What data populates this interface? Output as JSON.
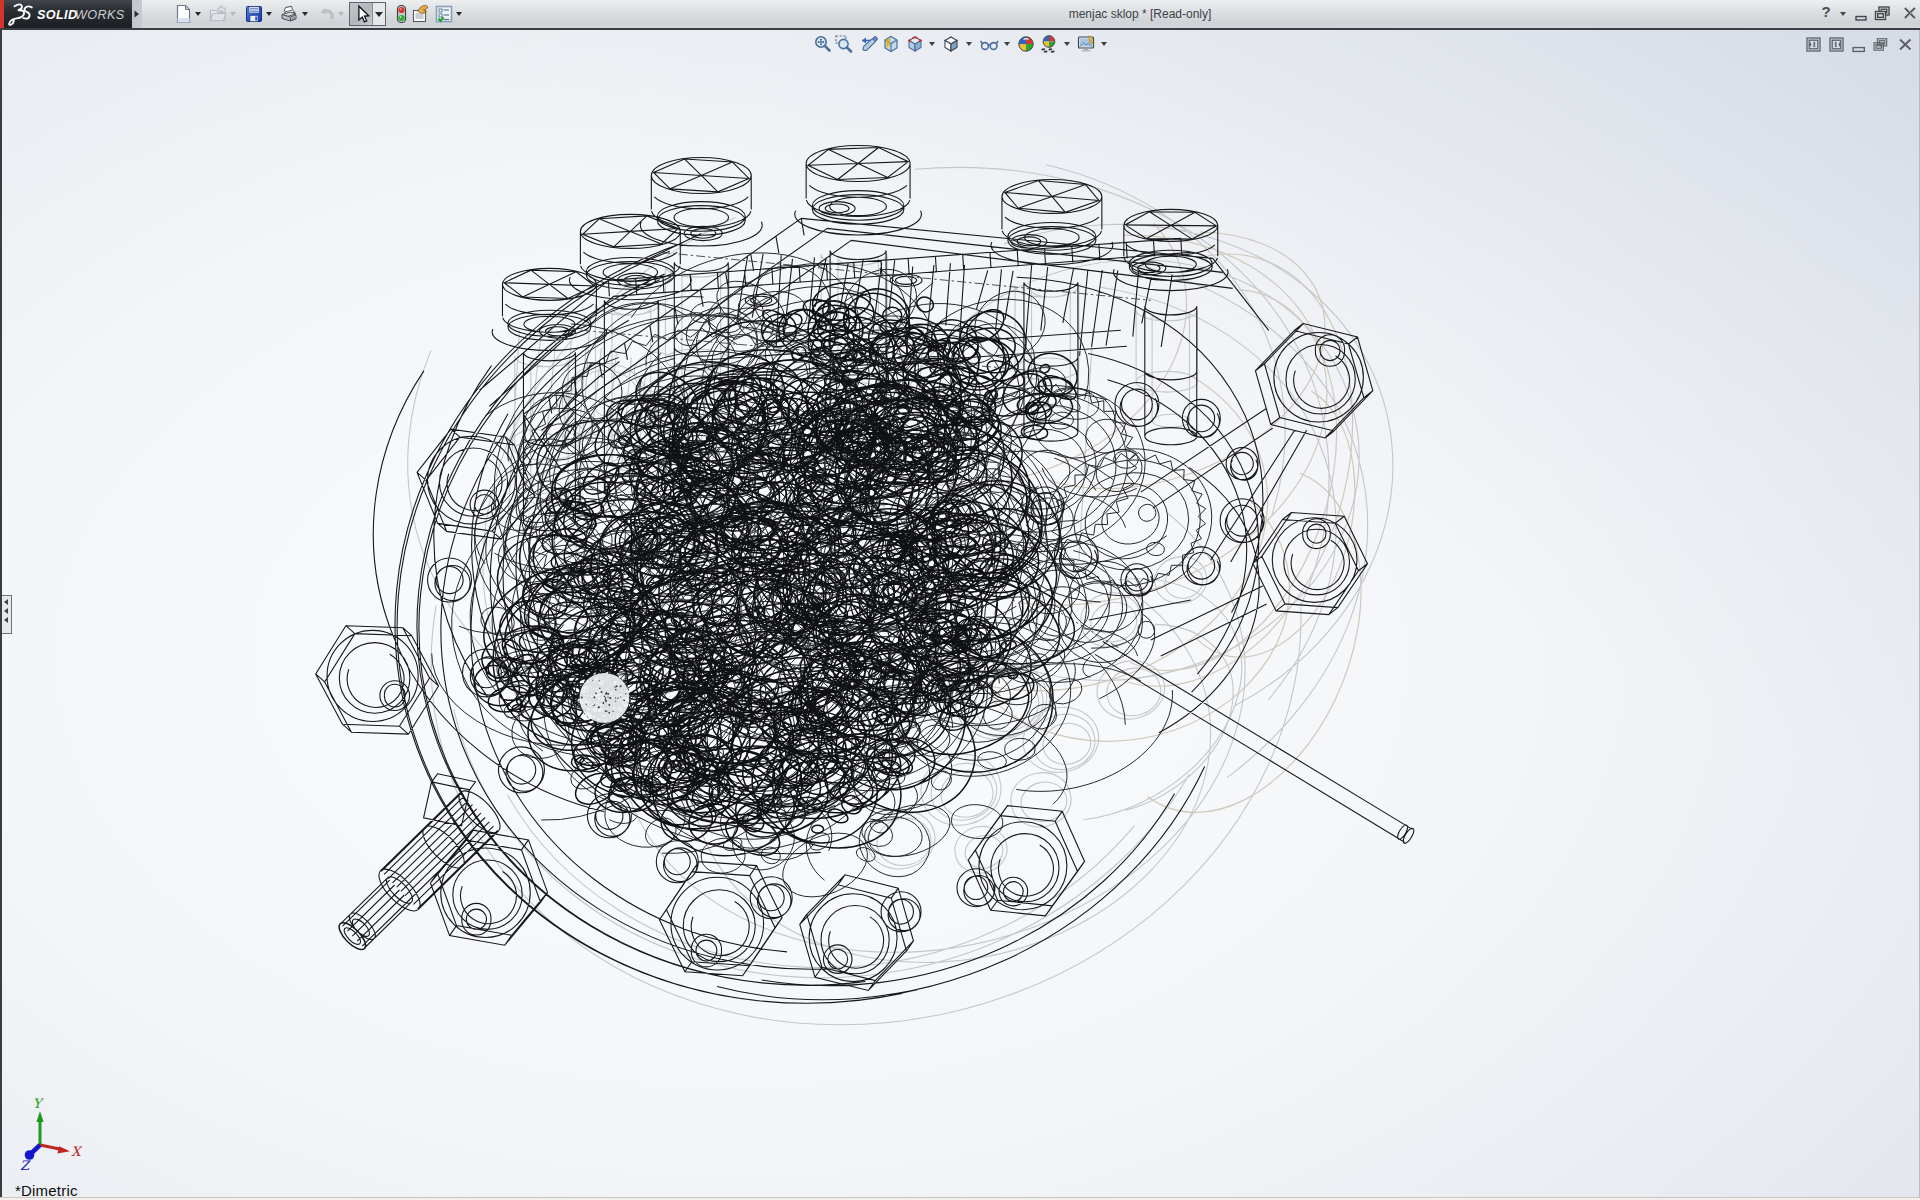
{
  "window": {
    "title": "menjac sklop * [Read-only]",
    "app_brand": {
      "mark": "DS",
      "word_primary": "SOLID",
      "word_secondary": "WORKS"
    },
    "controls": [
      {
        "name": "help",
        "glyph": "?"
      },
      {
        "name": "help-menu"
      },
      {
        "name": "minimize"
      },
      {
        "name": "restore"
      },
      {
        "name": "close"
      }
    ]
  },
  "standard_toolbar": {
    "items": [
      {
        "name": "new",
        "icon": "new-document-icon",
        "dropdown": true,
        "enabled": true
      },
      {
        "name": "open",
        "icon": "open-folder-icon",
        "dropdown": true,
        "enabled": false
      },
      {
        "name": "save",
        "icon": "save-floppy-icon",
        "dropdown": true,
        "enabled": true
      },
      {
        "name": "print",
        "icon": "print-icon",
        "dropdown": true,
        "enabled": true
      },
      {
        "name": "undo",
        "icon": "undo-icon",
        "dropdown": true,
        "enabled": false
      },
      {
        "name": "select",
        "icon": "select-cursor-icon",
        "dropdown": true,
        "enabled": true,
        "active": true
      },
      {
        "name": "stop-resume",
        "icon": "traffic-light-icon",
        "dropdown": false,
        "enabled": true
      },
      {
        "name": "file-properties",
        "icon": "hand-document-icon",
        "dropdown": false,
        "enabled": true
      },
      {
        "name": "options",
        "icon": "options-checklist-icon",
        "dropdown": true,
        "enabled": true
      },
      {
        "name": "toolbar-overflow",
        "icon": "chevron-down-icon",
        "dropdown": false,
        "enabled": true
      }
    ]
  },
  "heads_up_toolbar": {
    "items": [
      {
        "name": "zoom-to-fit",
        "icon": "zoom-fit-icon",
        "dropdown": false
      },
      {
        "name": "zoom-to-area",
        "icon": "zoom-area-icon",
        "dropdown": false
      },
      {
        "name": "previous-view",
        "icon": "previous-view-icon",
        "dropdown": false
      },
      {
        "name": "section-view",
        "icon": "section-view-icon",
        "dropdown": false
      },
      {
        "name": "view-orientation",
        "icon": "view-cube-icon",
        "dropdown": true
      },
      {
        "name": "display-style",
        "icon": "display-style-cube-icon",
        "dropdown": true
      },
      {
        "name": "hide-show-items",
        "icon": "eyeglasses-icon",
        "dropdown": true
      },
      {
        "name": "edit-appearance",
        "icon": "appearance-sphere-icon",
        "dropdown": false
      },
      {
        "name": "apply-scene",
        "icon": "scene-sphere-icon",
        "dropdown": true
      },
      {
        "name": "view-settings",
        "icon": "view-settings-monitor-icon",
        "dropdown": true
      }
    ]
  },
  "document_window": {
    "controls": [
      {
        "name": "dock-feature-pane-left"
      },
      {
        "name": "dock-feature-pane-right"
      },
      {
        "name": "minimize-document"
      },
      {
        "name": "restore-document"
      },
      {
        "name": "close-document"
      }
    ]
  },
  "viewport": {
    "view_label": "*Dimetric",
    "triad": {
      "x": "X",
      "y": "Y",
      "z": "Z"
    },
    "model": "gearbox assembly wireframe"
  },
  "colors": {
    "accent_red": "#d6332c",
    "titlebar": "#dcdfe2",
    "logo_bg": "#24272b",
    "viewport_center": "#fbfcfd",
    "viewport_edge": "#e2e5ec"
  }
}
